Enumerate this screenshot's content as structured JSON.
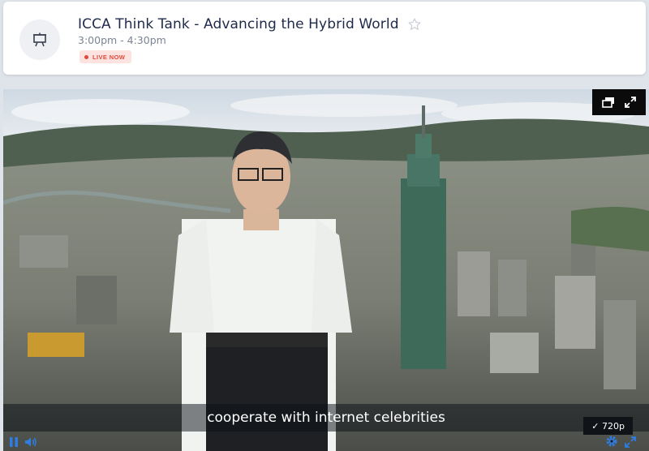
{
  "session": {
    "title": "ICCA Think Tank - Advancing the Hybrid World",
    "time": "3:00pm - 4:30pm",
    "live_label": "LIVE NOW"
  },
  "player": {
    "caption": "cooperate with internet celebrities",
    "quality_option": "✓ 720p"
  },
  "icons": {
    "session": "presentation-board-icon",
    "favorite": "star-outline-icon",
    "pip": "picture-in-picture-icon",
    "fullscreen": "expand-icon",
    "pause": "pause-icon",
    "volume": "volume-icon",
    "settings": "gear-icon",
    "fullscreen_bottom": "fullscreen-icon"
  },
  "colors": {
    "accent": "#2f7de1",
    "live": "#e5463a",
    "title": "#1e2a4a"
  }
}
